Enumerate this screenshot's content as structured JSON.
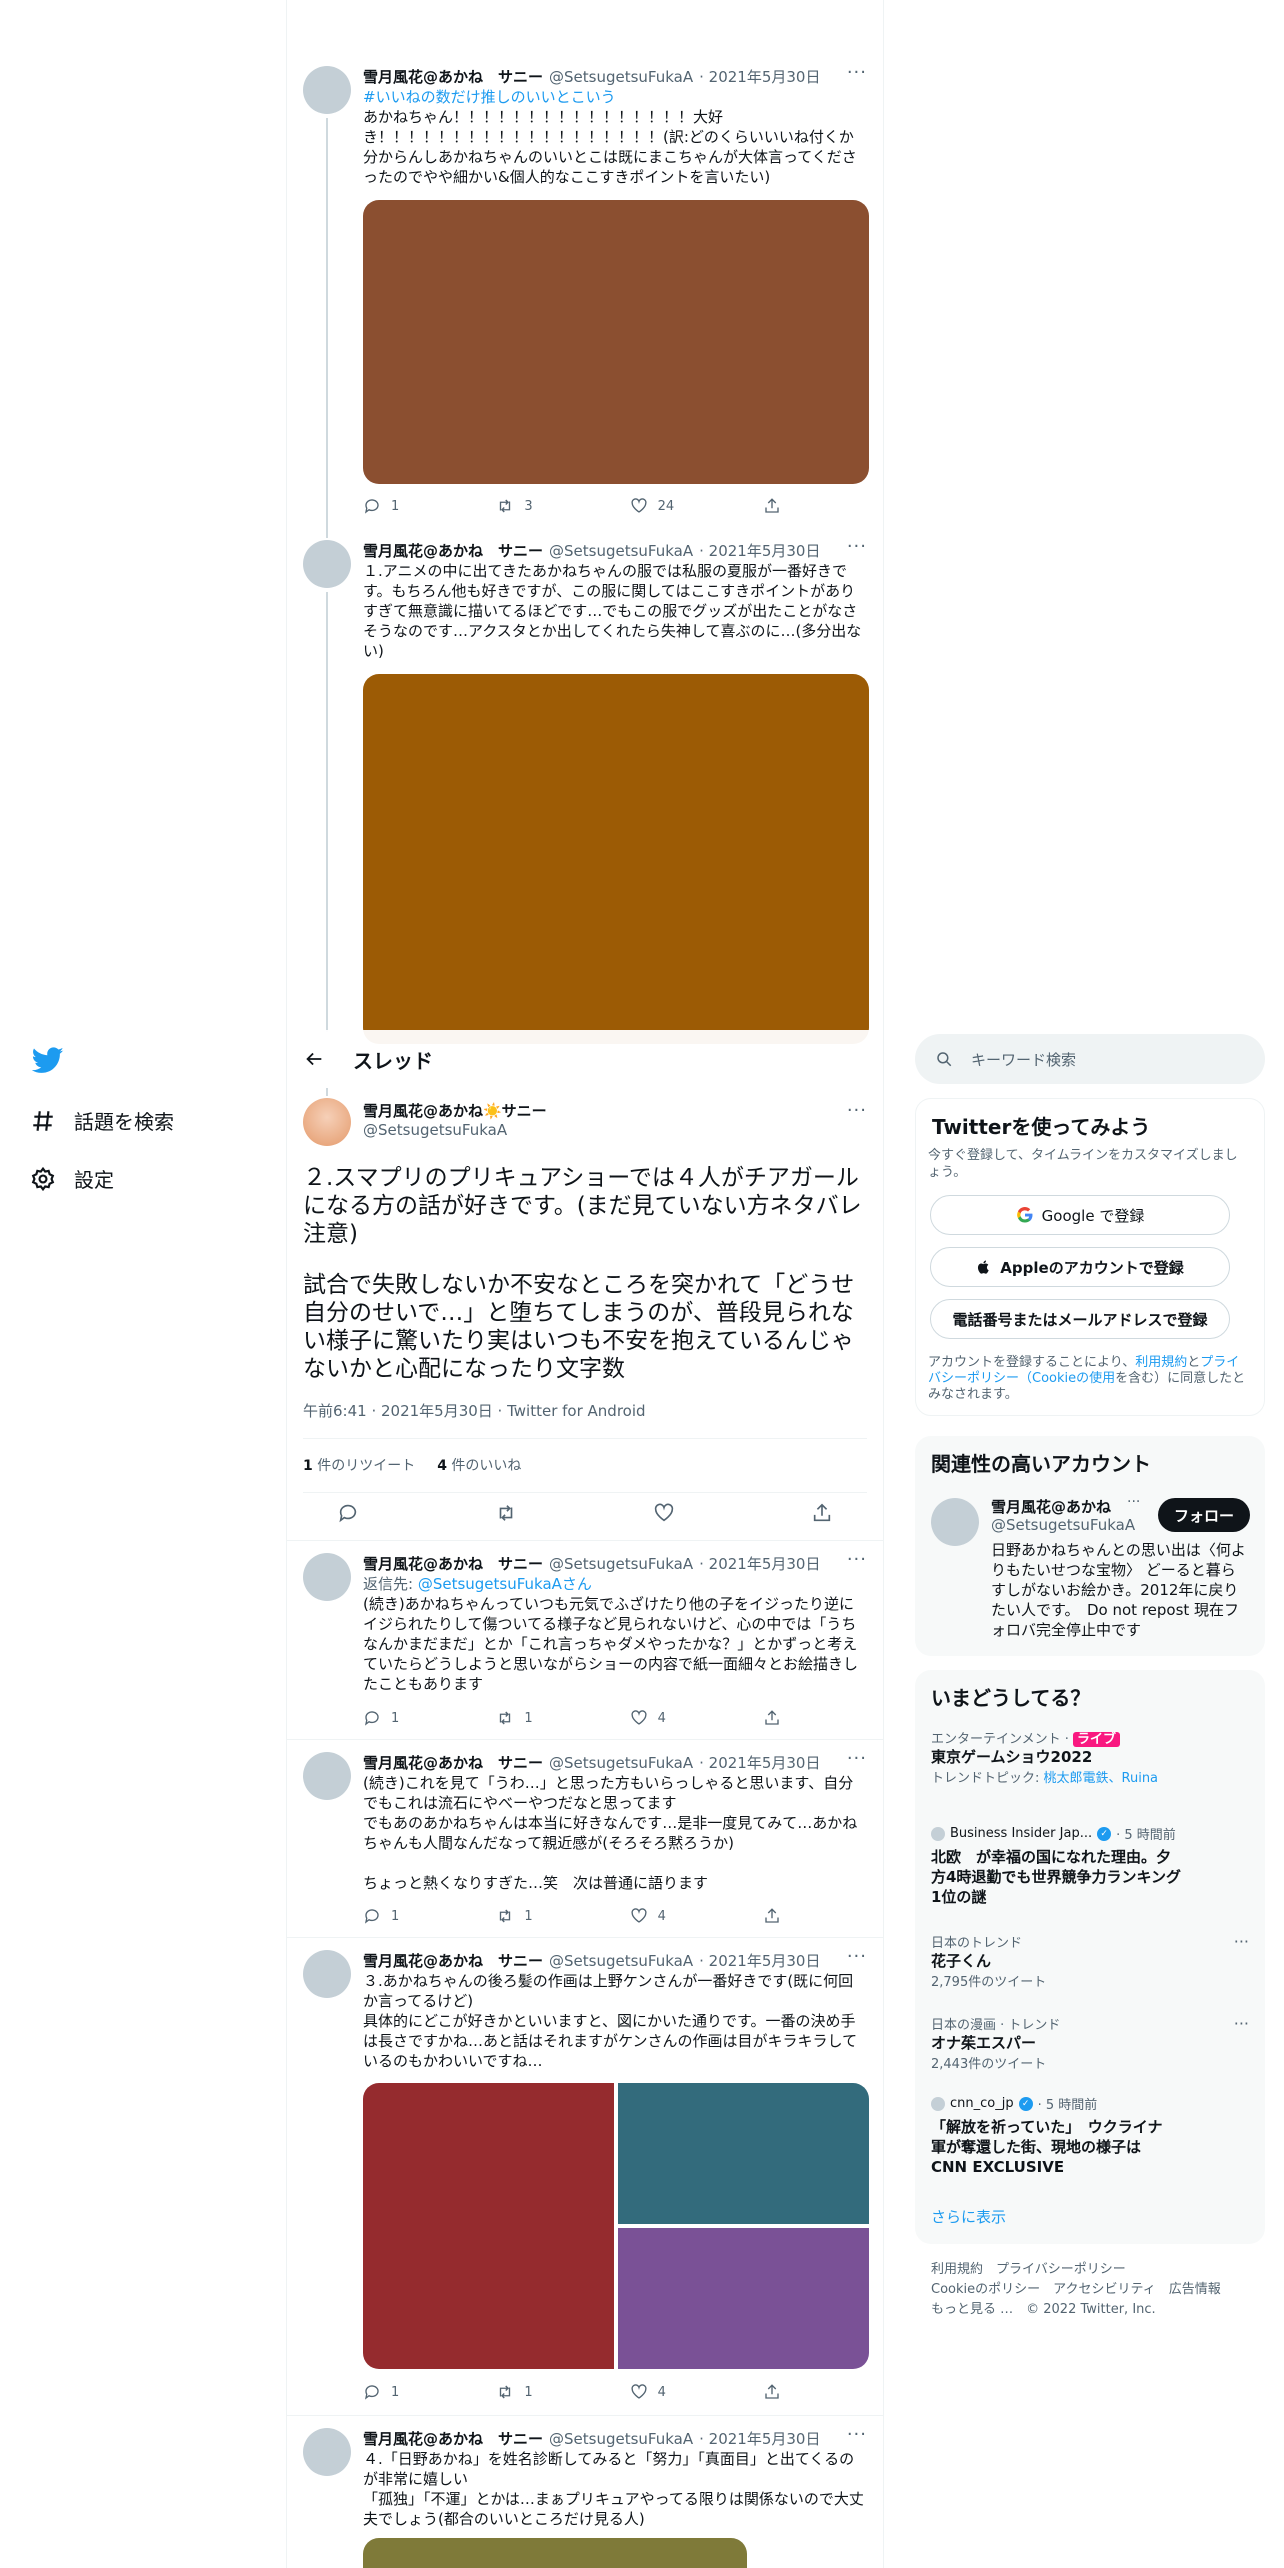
{
  "nav": {
    "logo": "twitter-bird",
    "explore_label": "話題を検索",
    "settings_label": "設定"
  },
  "thread_header": {
    "title": "スレッド"
  },
  "tweets_above": [
    {
      "name": "雪月風花@あかね　サニー",
      "handle": "@SetsugetsuFukaA",
      "date": "· 2021年5月30日",
      "hashtag": "#いいねの数だけ推しのいいとこいう",
      "text": "あかねちゃん！！！！！！！！！！！！！！！！大好き！！！！！！！！！！！！！！！！！！！(訳:どのくらいいいね付くか分からんしあかねちゃんのいいとこは既にまこちゃんが大体言ってくださったのでやや細かい&個人的なここすきポイントを言いたい)",
      "media_color": "#8b4f30",
      "replies": "1",
      "retweets": "3",
      "likes": "24"
    },
    {
      "name": "雪月風花@あかね　サニー",
      "handle": "@SetsugetsuFukaA",
      "date": "· 2021年5月30日",
      "text": "１.アニメの中に出てきたあかねちゃんの服では私服の夏服が一番好きです。もちろん他も好きですが、この服に関してはここすきポイントがありすぎて無意識に描いてるほどです…でもこの服でグッズが出たことがなさそうなのです…アクスタとか出してくれたら失神して喜ぶのに…(多分出ない)",
      "media_color": "#9c5b05"
    }
  ],
  "main_tweet": {
    "name": "雪月風花@あかね☀️サニー",
    "handle": "@SetsugetsuFukaA",
    "text1": "２.スマプリのプリキュアショーでは４人がチアガールになる方の話が好きです。(まだ見ていない方ネタバレ注意)",
    "text2": "試合で失敗しないか不安なところを突かれて「どうせ自分のせいで…」と堕ちてしまうのが、普段見られない様子に驚いたり実はいつも不安を抱えているんじゃないかと心配になったり文字数",
    "meta": "午前6:41 · 2021年5月30日 · Twitter for Android",
    "retweet_count": "1",
    "retweet_label": "件のリツイート",
    "like_count": "4",
    "like_label": "件のいいね"
  },
  "replies": [
    {
      "name": "雪月風花@あかね　サニー",
      "handle": "@SetsugetsuFukaA",
      "date": "· 2021年5月30日",
      "reply_to_label": "返信先: ",
      "reply_to_handle": "@SetsugetsuFukaAさん",
      "text": "(続き)あかねちゃんっていつも元気でふざけたり他の子をイジったり逆にイジられたりして傷ついてる様子など見られないけど、心の中では「うちなんかまだまだ」とか「これ言っちゃダメやったかな？」とかずっと考えていたらどうしようと思いながらショーの内容で紙一面細々とお絵描きしたこともあります",
      "replies": "1",
      "retweets": "1",
      "likes": "4"
    },
    {
      "name": "雪月風花@あかね　サニー",
      "handle": "@SetsugetsuFukaA",
      "date": "· 2021年5月30日",
      "text": "(続き)これを見て「うわ…」と思った方もいらっしゃると思います、自分でもこれは流石にやべーやつだなと思ってます\nでもあのあかねちゃんは本当に好きなんです…是非一度見てみて…あかねちゃんも人間なんだなって親近感が(そろそろ黙ろうか)\n\nちょっと熱くなりすぎた…笑　次は普通に語ります",
      "replies": "1",
      "retweets": "1",
      "likes": "4"
    },
    {
      "name": "雪月風花@あかね　サニー",
      "handle": "@SetsugetsuFukaA",
      "date": "· 2021年5月30日",
      "text": "３.あかねちゃんの後ろ髪の作画は上野ケンさんが一番好きです(既に何回か言ってるけど)\n具体的にどこが好きかといいますと、図にかいた通りです。一番の決め手は長さですかね…あと話はそれますがケンさんの作画は目がキラキラしているのもかわいいですね…",
      "media_colors": [
        "#952b2e",
        "#336b7c",
        "#7a5196"
      ],
      "replies": "1",
      "retweets": "1",
      "likes": "4"
    },
    {
      "name": "雪月風花@あかね　サニー",
      "handle": "@SetsugetsuFukaA",
      "date": "· 2021年5月30日",
      "text": "４.「日野あかね」を姓名診断してみると「努力」「真面目」と出てくるのが非常に嬉しい\n「孤独」「不運」とかは…まぁプリキュアやってる限りは関係ないので大丈夫でしょう(都合のいいところだけ見る人)",
      "media_color": "#7f7a39"
    }
  ],
  "search": {
    "placeholder": "キーワード検索"
  },
  "signup": {
    "title": "Twitterを使ってみよう",
    "subtitle": "今すぐ登録して、タイムラインをカスタマイズしましょう。",
    "google_label": "Google で登録",
    "apple_label": "Appleのアカウントで登録",
    "phone_label": "電話番号またはメールアドレスで登録",
    "terms_prefix": "アカウントを登録することにより、",
    "terms_link": "利用規約",
    "terms_and": "と",
    "privacy_link": "プライバシーポリシー（Cookieの使用",
    "terms_suffix": "を含む）に同意したとみなされます。"
  },
  "related": {
    "title": "関連性の高いアカウント",
    "name": "雪月風花@あかね",
    "handle": "@SetsugetsuFukaA",
    "follow_label": "フォロー",
    "bio": "日野あかねちゃんとの思い出は〈何よりもたいせつな宝物〉 どーると暮らすしがないお絵かき。2012年に戻りたい人です。　Do not repost 現在フォロバ完全停止中です"
  },
  "trends": {
    "title": "いまどうしてる？",
    "items": [
      {
        "meta": "エンターテインメント · ",
        "badge": "ライブ",
        "title": "東京ゲームショウ2022",
        "sub_prefix": "トレンドトピック: ",
        "sub_links": "桃太郎電鉄、Ruina"
      },
      {
        "source": "Business Insider Jap...",
        "time": "· 5 時間前",
        "title": "北欧　が幸福の国になれた理由。夕方4時退勤でも世界競争力ランキング1位の謎"
      },
      {
        "meta": "日本のトレンド",
        "title": "花子くん",
        "count": "2,795件のツイート"
      },
      {
        "meta": "日本の漫画 · トレンド",
        "title": "オナ茱エスパー",
        "count": "2,443件のツイート"
      },
      {
        "source": "cnn_co_jp",
        "time": "· 5 時間前",
        "title": "「解放を祈っていた」　ウクライナ軍が奪還した街、現地の様子は CNN EXCLUSIVE"
      }
    ],
    "show_more": "さらに表示"
  },
  "footer": {
    "line1": "利用規約　プライバシーポリシー",
    "line2": "Cookieのポリシー　アクセシビリティ　広告情報",
    "line3": "もっと見る …　© 2022 Twitter, Inc."
  },
  "colors": {
    "accent": "#1d9bf0",
    "live_badge": "#f91880"
  }
}
